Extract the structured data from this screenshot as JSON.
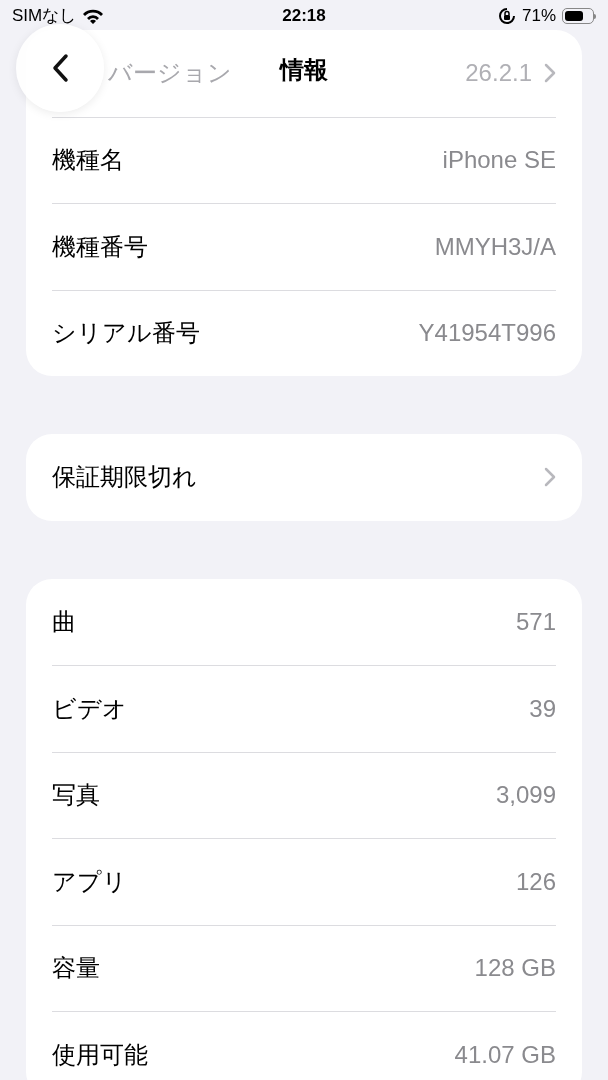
{
  "status_bar": {
    "carrier": "SIMなし",
    "time": "22:18",
    "battery": "71%"
  },
  "nav": {
    "title": "情報"
  },
  "groups": [
    {
      "rows": [
        {
          "label": "バージョン",
          "value": "26.2.1",
          "chevron": true,
          "faded": true
        },
        {
          "label": "機種名",
          "value": "iPhone SE"
        },
        {
          "label": "機種番号",
          "value": "MMYH3J/A"
        },
        {
          "label": "シリアル番号",
          "value": "Y41954T996"
        }
      ]
    },
    {
      "rows": [
        {
          "label": "保証期限切れ",
          "chevron": true
        }
      ]
    },
    {
      "rows": [
        {
          "label": "曲",
          "value": "571"
        },
        {
          "label": "ビデオ",
          "value": "39"
        },
        {
          "label": "写真",
          "value": "3,099"
        },
        {
          "label": "アプリ",
          "value": "126"
        },
        {
          "label": "容量",
          "value": "128 GB"
        },
        {
          "label": "使用可能",
          "value": "41.07 GB"
        }
      ]
    }
  ]
}
